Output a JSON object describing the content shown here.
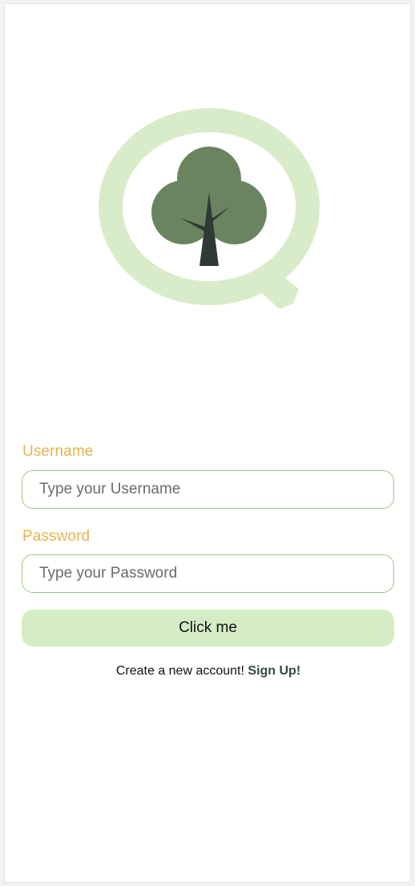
{
  "login_form": {
    "username_label": "Username",
    "username_placeholder": "Type your Username",
    "password_label": "Password",
    "password_placeholder": "Type your Password",
    "submit_label": "Click me"
  },
  "signup": {
    "prompt": "Create a new account! ",
    "link_label": "Sign Up!"
  },
  "logo": {
    "icon": "tree-magnifier-icon",
    "ring_color": "#d9ecc9",
    "canopy_color": "#6b8460",
    "trunk_color": "#2f3a36"
  },
  "colors": {
    "label_color": "#e4b54c",
    "input_border": "#9bc78a",
    "button_bg": "#d4edc7",
    "link_color": "#2f4a3a"
  }
}
